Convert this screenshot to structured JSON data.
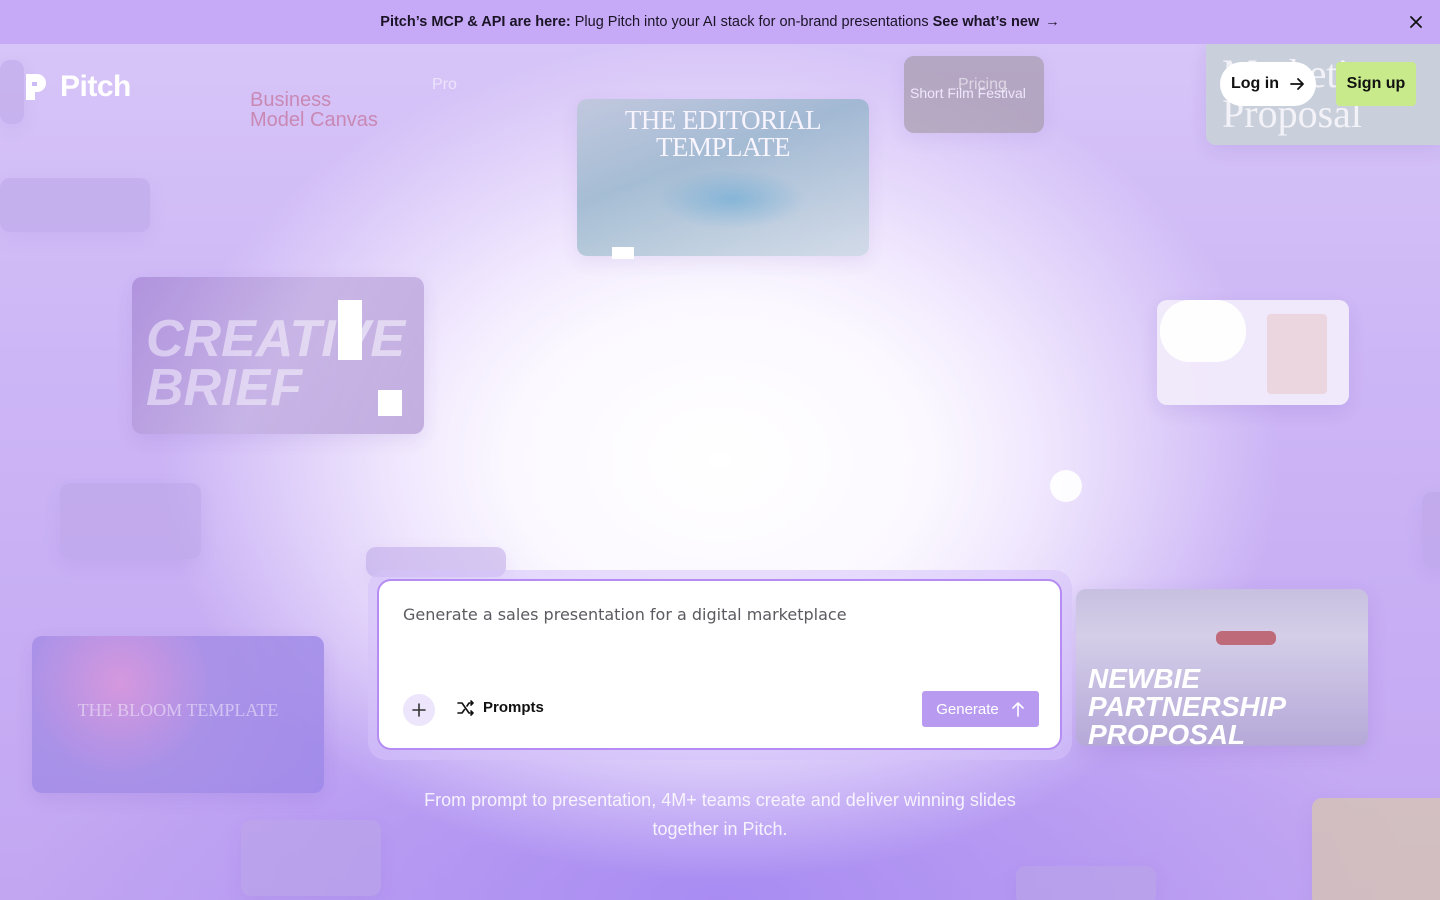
{
  "announcement": {
    "lead": "Pitch’s MCP & API are here:",
    "body": "Plug Pitch into your AI stack for on-brand presentations",
    "link": "See what’s new",
    "arrow": "→",
    "close_icon": "close-icon"
  },
  "header": {
    "logo_text": "Pitch",
    "nav": {
      "product": "Pro",
      "pricing": "Pricing"
    },
    "login_label": "Log in",
    "signup_label": "Sign up"
  },
  "templates": {
    "editorial": "THE EDITORIAL TEMPLATE",
    "creative_brief": "CREATIVE BRIEF",
    "bloom": "THE BLOOM TEMPLATE",
    "newbie": "NEWBIE PARTNERSHIP PROPOSAL",
    "marketing": "Marketing Proposal",
    "business": "Business Model Canvas",
    "film": "Short Film Festival"
  },
  "prompt": {
    "placeholder": "Generate a sales presentation for a digital marketplace",
    "prompts_label": "Prompts",
    "generate_label": "Generate"
  },
  "subtitle": "From prompt to presentation, 4M+ teams create and deliver winning slides together in Pitch.",
  "colors": {
    "topbar": "#c7aaf7",
    "signup": "#c8ea8b",
    "generate": "#b89bf0",
    "prompt_border": "#b58cf3"
  }
}
